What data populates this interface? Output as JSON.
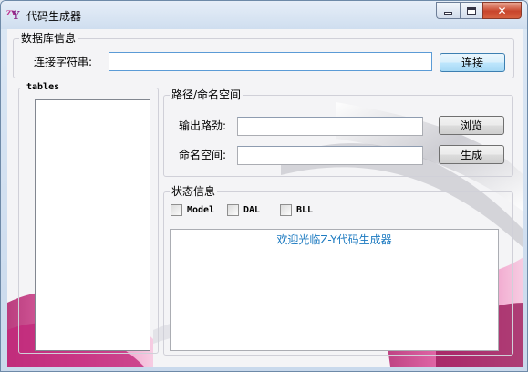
{
  "window": {
    "title": "代码生成器",
    "icon_text_small": "ZY",
    "icon_text_big": "Y"
  },
  "db_group": {
    "title": "数据库信息",
    "conn_label": "连接字符串:",
    "conn_value": "",
    "connect_button": "连接"
  },
  "tables_group": {
    "title": "tables",
    "items": []
  },
  "path_group": {
    "title": "路径/命名空间",
    "output_label": "输出路劲:",
    "output_value": "",
    "browse_button": "浏览",
    "namespace_label": "命名空间:",
    "namespace_value": "",
    "generate_button": "生成"
  },
  "status_group": {
    "title": "状态信息",
    "checks": [
      {
        "label": "Model",
        "checked": false
      },
      {
        "label": "DAL",
        "checked": false
      },
      {
        "label": "BLL",
        "checked": false
      }
    ],
    "message": "欢迎光临Z-Y代码生成器"
  },
  "colors": {
    "accent_pink": "#d23c8c",
    "message_blue": "#1c7ac0"
  }
}
